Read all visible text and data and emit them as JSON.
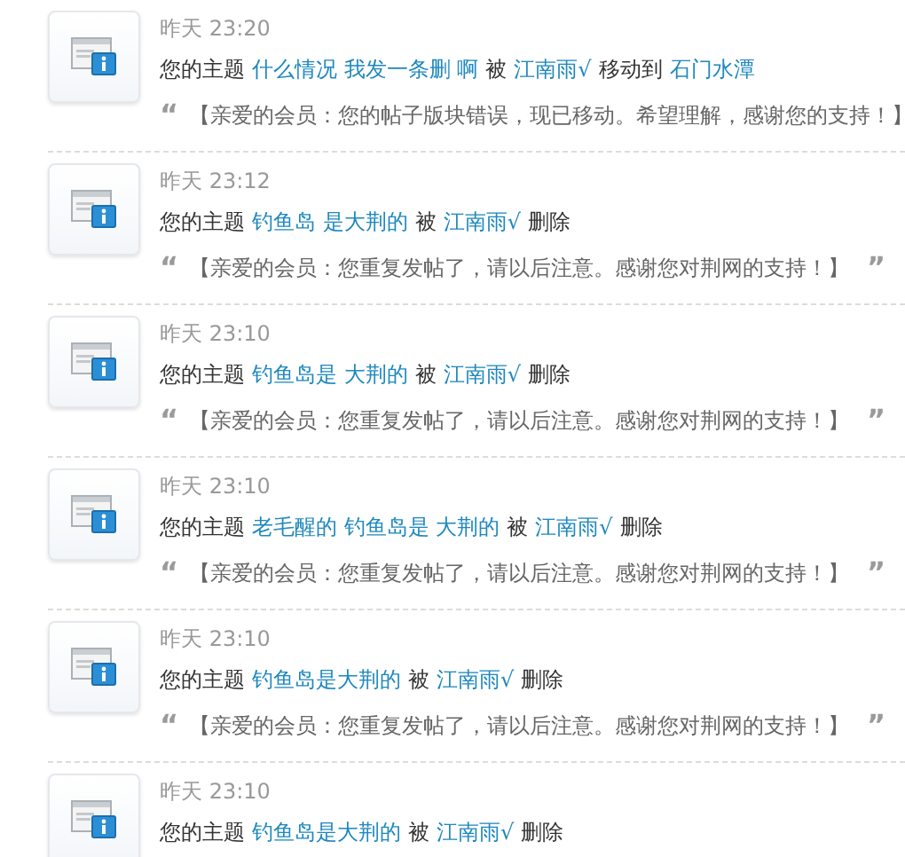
{
  "notices": [
    {
      "time": "昨天 23:20",
      "message": [
        {
          "kind": "text",
          "text": "您的主题"
        },
        {
          "kind": "link",
          "text": "什么情况 我发一条删 啊"
        },
        {
          "kind": "text",
          "text": "被"
        },
        {
          "kind": "link",
          "text": "江南雨√"
        },
        {
          "kind": "text",
          "text": "移动到"
        },
        {
          "kind": "link",
          "text": "石门水潭"
        }
      ],
      "quote": {
        "open_mark": "“",
        "text": "【亲爱的会员：您的帖子版块错误，现已移动。希望理解，感谢您的支持！】"
      }
    },
    {
      "time": "昨天 23:12",
      "message": [
        {
          "kind": "text",
          "text": "您的主题"
        },
        {
          "kind": "link",
          "text": "钓鱼岛 是大荆的"
        },
        {
          "kind": "text",
          "text": "被"
        },
        {
          "kind": "link",
          "text": "江南雨√"
        },
        {
          "kind": "text",
          "text": "删除"
        }
      ],
      "quote": {
        "open_mark": "“",
        "text": "【亲爱的会员：您重复发帖了，请以后注意。感谢您对荆网的支持！】",
        "close_mark": "”"
      }
    },
    {
      "time": "昨天 23:10",
      "message": [
        {
          "kind": "text",
          "text": "您的主题"
        },
        {
          "kind": "link",
          "text": "钓鱼岛是 大荆的"
        },
        {
          "kind": "text",
          "text": "被"
        },
        {
          "kind": "link",
          "text": "江南雨√"
        },
        {
          "kind": "text",
          "text": "删除"
        }
      ],
      "quote": {
        "open_mark": "“",
        "text": "【亲爱的会员：您重复发帖了，请以后注意。感谢您对荆网的支持！】",
        "close_mark": "”"
      }
    },
    {
      "time": "昨天 23:10",
      "message": [
        {
          "kind": "text",
          "text": "您的主题"
        },
        {
          "kind": "link",
          "text": "老毛醒的 钓鱼岛是 大荆的"
        },
        {
          "kind": "text",
          "text": "被"
        },
        {
          "kind": "link",
          "text": "江南雨√"
        },
        {
          "kind": "text",
          "text": "删除"
        }
      ],
      "quote": {
        "open_mark": "“",
        "text": "【亲爱的会员：您重复发帖了，请以后注意。感谢您对荆网的支持！】",
        "close_mark": "”"
      }
    },
    {
      "time": "昨天 23:10",
      "message": [
        {
          "kind": "text",
          "text": "您的主题"
        },
        {
          "kind": "link",
          "text": "钓鱼岛是大荆的"
        },
        {
          "kind": "text",
          "text": "被"
        },
        {
          "kind": "link",
          "text": "江南雨√"
        },
        {
          "kind": "text",
          "text": "删除"
        }
      ],
      "quote": {
        "open_mark": "“",
        "text": "【亲爱的会员：您重复发帖了，请以后注意。感谢您对荆网的支持！】",
        "close_mark": "”"
      }
    },
    {
      "time": "昨天 23:10",
      "message": [
        {
          "kind": "text",
          "text": "您的主题"
        },
        {
          "kind": "link",
          "text": "钓鱼岛是大荆的"
        },
        {
          "kind": "text",
          "text": "被"
        },
        {
          "kind": "link",
          "text": "江南雨√"
        },
        {
          "kind": "text",
          "text": "删除"
        }
      ]
    }
  ]
}
